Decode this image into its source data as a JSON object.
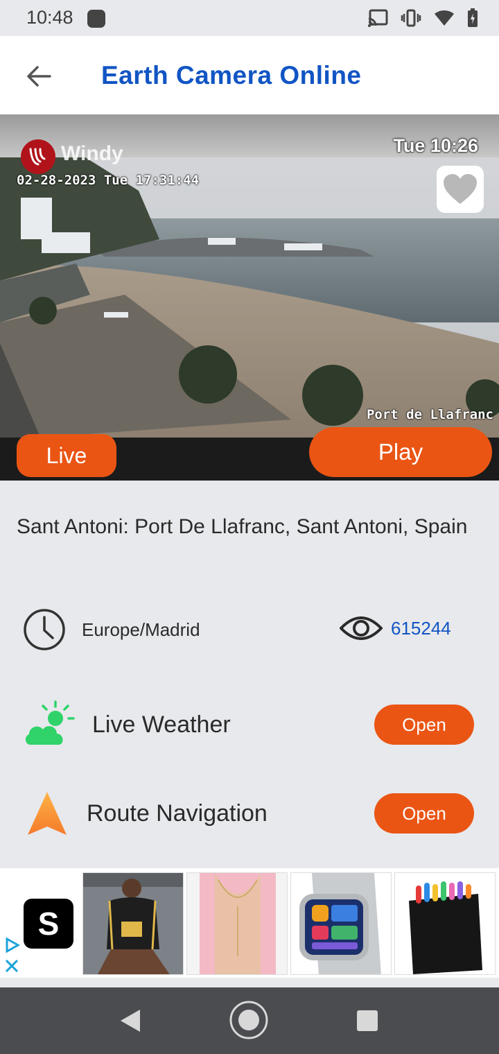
{
  "status_bar": {
    "time": "10:48"
  },
  "app_bar": {
    "title": "Earth Camera Online"
  },
  "camera": {
    "brand": "Windy",
    "clock": "Tue 10:26",
    "timestamp": "02-28-2023 Tue 17:31:44",
    "place_label": "Port de Llafranc",
    "live_label": "Live",
    "play_label": "Play"
  },
  "details": {
    "location": "Sant Antoni: Port De Llafranc, Sant Antoni, Spain",
    "timezone": "Europe/Madrid",
    "views": "615244"
  },
  "features": [
    {
      "label": "Live Weather",
      "button": "Open",
      "icon": "weather-icon"
    },
    {
      "label": "Route Navigation",
      "button": "Open",
      "icon": "navigation-arrow-icon"
    }
  ],
  "ad": {
    "logo_letter": "S"
  },
  "colors": {
    "accent": "#ea5514",
    "title_blue": "#1155c4"
  }
}
